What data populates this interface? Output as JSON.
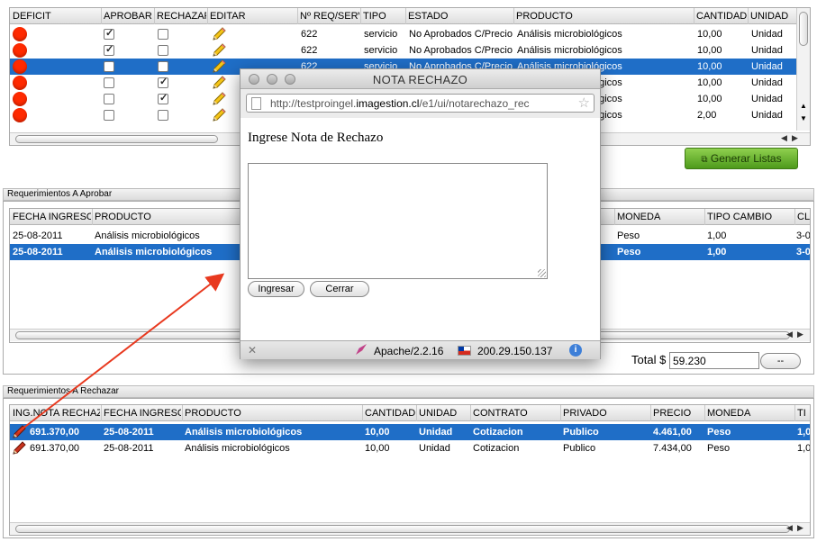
{
  "top_grid": {
    "headers": [
      "DEFICIT",
      "APROBAR",
      "RECHAZAR",
      "EDITAR",
      "Nº REQ/SERV",
      "TIPO",
      "ESTADO",
      "PRODUCTO",
      "CANTIDAD",
      "UNIDAD"
    ],
    "rows": [
      {
        "aprobar": true,
        "rechazar": false,
        "req": "622",
        "tipo": "servicio",
        "estado": "No Aprobados C/Precio",
        "producto": "Análisis microbiológicos",
        "cantidad": "10,00",
        "unidad": "Unidad",
        "selected": false
      },
      {
        "aprobar": true,
        "rechazar": false,
        "req": "622",
        "tipo": "servicio",
        "estado": "No Aprobados C/Precio",
        "producto": "Análisis microbiológicos",
        "cantidad": "10,00",
        "unidad": "Unidad",
        "selected": false
      },
      {
        "aprobar": false,
        "rechazar": false,
        "req": "622",
        "tipo": "servicio",
        "estado": "No Aprobados C/Precio",
        "producto": "Análisis microbiológicos",
        "cantidad": "10,00",
        "unidad": "Unidad",
        "selected": true
      },
      {
        "aprobar": false,
        "rechazar": true,
        "req": "",
        "tipo": "",
        "estado": "",
        "producto": "Análisis microbiológicos",
        "cantidad": "10,00",
        "unidad": "Unidad",
        "selected": false
      },
      {
        "aprobar": false,
        "rechazar": true,
        "req": "",
        "tipo": "",
        "estado": "",
        "producto": "Análisis microbiológicos",
        "cantidad": "10,00",
        "unidad": "Unidad",
        "selected": false
      },
      {
        "aprobar": false,
        "rechazar": false,
        "req": "",
        "tipo": "",
        "estado": "",
        "producto": "Análisis microbiológicos",
        "cantidad": "2,00",
        "unidad": "Unidad",
        "selected": false
      }
    ]
  },
  "generate_button": {
    "label": "Generar Listas"
  },
  "approve_section": {
    "title": "Requerimientos A Aprobar",
    "headers": [
      "FECHA INGRESO",
      "PRODUCTO",
      "MONEDA",
      "TIPO CAMBIO",
      "CL"
    ],
    "rows": [
      {
        "fecha": "25-08-2011",
        "producto": "Análisis microbiológicos",
        "moneda": "Peso",
        "cambio": "1,00",
        "cl": "3-0",
        "selected": false
      },
      {
        "fecha": "25-08-2011",
        "producto": "Análisis microbiológicos",
        "moneda": "Peso",
        "cambio": "1,00",
        "cl": "3-0",
        "selected": true
      }
    ],
    "total_label": "Total $",
    "total_value": "59.230",
    "total_button": "--"
  },
  "reject_section": {
    "title": "Requerimientos A Rechazar",
    "headers": [
      "ING.NOTA RECHAZO",
      "FECHA INGRESO",
      "PRODUCTO",
      "CANTIDAD",
      "UNIDAD",
      "CONTRATO",
      "PRIVADO",
      "PRECIO",
      "MONEDA",
      "TI"
    ],
    "rows": [
      {
        "nota": "691.370,00",
        "fecha": "25-08-2011",
        "producto": "Análisis microbiológicos",
        "cantidad": "10,00",
        "unidad": "Unidad",
        "contrato": "Cotizacion",
        "privado": "Publico",
        "precio": "4.461,00",
        "moneda": "Peso",
        "ti": "1,0",
        "selected": true
      },
      {
        "nota": "691.370,00",
        "fecha": "25-08-2011",
        "producto": "Análisis microbiológicos",
        "cantidad": "10,00",
        "unidad": "Unidad",
        "contrato": "Cotizacion",
        "privado": "Publico",
        "precio": "7.434,00",
        "moneda": "Peso",
        "ti": "1,0",
        "selected": false
      }
    ]
  },
  "popup": {
    "title": "NOTA RECHAZO",
    "url_prefix": "http://testproingel.",
    "url_domain": "imagestion.cl",
    "url_rest": "/e1/ui/notarechazo_rec",
    "heading": "Ingrese Nota de Rechazo",
    "textarea_value": "",
    "ingresar_label": "Ingresar",
    "cerrar_label": "Cerrar",
    "status_server": "Apache/2.2.16",
    "status_ip": "200.29.150.137"
  },
  "colors": {
    "selection": "#1f6ec7",
    "deficit_dot": "#ff2a00",
    "arrow": "#e8391f",
    "green_button": "#5fae24"
  }
}
